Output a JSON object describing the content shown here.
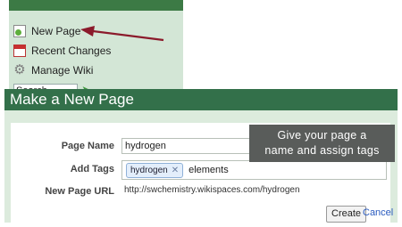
{
  "sidebar": {
    "items": [
      {
        "label": "New Page",
        "icon": "new-page-icon"
      },
      {
        "label": "Recent Changes",
        "icon": "calendar-icon"
      },
      {
        "label": "Manage Wiki",
        "icon": "gear-icon"
      }
    ],
    "search": {
      "value": "Search"
    }
  },
  "dialog": {
    "title": "Make a New Page",
    "page_name": {
      "label": "Page Name",
      "value": "hydrogen"
    },
    "add_tags": {
      "label": "Add Tags",
      "tags": [
        "hydrogen"
      ],
      "typed": "elements"
    },
    "new_page_url": {
      "label": "New Page URL",
      "value": "http://swchemistry.wikispaces.com/hydrogen"
    },
    "create_label": "Create",
    "cancel_label": "Cancel"
  },
  "annotation": {
    "line1": "Give your page a",
    "line2": "name and assign tags",
    "arrow_color": "#8b1a2b"
  },
  "colors": {
    "sidebar_bg": "#d3e6d6",
    "header_green": "#33704a",
    "tooltip_bg": "#595c5a"
  }
}
